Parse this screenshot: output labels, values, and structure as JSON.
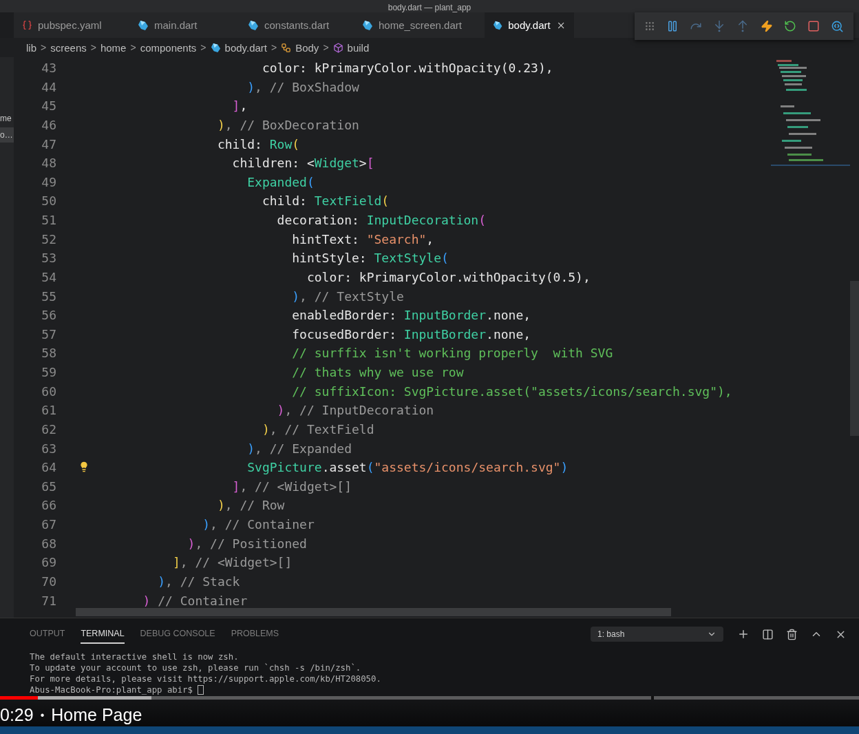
{
  "window": {
    "title": "body.dart — plant_app"
  },
  "tabs": [
    {
      "label": "pubspec.yaml",
      "kind": "yaml",
      "selected": false
    },
    {
      "label": "main.dart",
      "kind": "dart",
      "selected": false
    },
    {
      "label": "constants.dart",
      "kind": "dart",
      "selected": false
    },
    {
      "label": "home_screen.dart",
      "kind": "dart",
      "selected": false
    },
    {
      "label": "body.dart",
      "kind": "dart",
      "selected": true
    }
  ],
  "breadcrumbs": [
    {
      "label": "lib",
      "kind": "folder"
    },
    {
      "separator": ">",
      "label": "screens",
      "kind": "folder"
    },
    {
      "separator": ">",
      "label": "home",
      "kind": "folder"
    },
    {
      "separator": ">",
      "label": "components",
      "kind": "folder"
    },
    {
      "separator": ">",
      "label": "body.dart",
      "kind": "dart"
    },
    {
      "separator": ">",
      "label": "Body",
      "kind": "class"
    },
    {
      "separator": ">",
      "label": "build",
      "kind": "method"
    }
  ],
  "sidebar": {
    "items": [
      {
        "label": "me",
        "selected": false
      },
      {
        "label": "o…",
        "selected": true
      }
    ]
  },
  "editor": {
    "lines": [
      {
        "number": "43",
        "tokens": [
          {
            "t": "                         color: kPrimaryColor.withOpacity(0.23),",
            "kind": "plain"
          }
        ]
      },
      {
        "number": "44",
        "tokens": [
          {
            "t": "                       )",
            "kind": "bracket3"
          },
          {
            "t": ", // BoxShadow",
            "kind": "comment"
          }
        ]
      },
      {
        "number": "45",
        "tokens": [
          {
            "t": "                     ]",
            "kind": "bracket2"
          },
          {
            "t": ",",
            "kind": "plain"
          }
        ]
      },
      {
        "number": "46",
        "tokens": [
          {
            "t": "                   )",
            "kind": "bracket1"
          },
          {
            "t": ", // BoxDecoration",
            "kind": "comment"
          }
        ]
      },
      {
        "number": "47",
        "tokens": [
          {
            "t": "                   child: ",
            "kind": "plain"
          },
          {
            "t": "Row",
            "kind": "type"
          },
          {
            "t": "(",
            "kind": "bracket1"
          }
        ]
      },
      {
        "number": "48",
        "tokens": [
          {
            "t": "                     children: <",
            "kind": "plain"
          },
          {
            "t": "Widget",
            "kind": "type"
          },
          {
            "t": ">",
            "kind": "plain"
          },
          {
            "t": "[",
            "kind": "bracket2"
          }
        ]
      },
      {
        "number": "49",
        "tokens": [
          {
            "t": "                       Expanded",
            "kind": "type"
          },
          {
            "t": "(",
            "kind": "bracket3"
          }
        ]
      },
      {
        "number": "50",
        "tokens": [
          {
            "t": "                         child: ",
            "kind": "plain"
          },
          {
            "t": "TextField",
            "kind": "type"
          },
          {
            "t": "(",
            "kind": "bracket1"
          }
        ]
      },
      {
        "number": "51",
        "tokens": [
          {
            "t": "                           decoration: ",
            "kind": "plain"
          },
          {
            "t": "InputDecoration",
            "kind": "type"
          },
          {
            "t": "(",
            "kind": "bracket2"
          }
        ]
      },
      {
        "number": "52",
        "tokens": [
          {
            "t": "                             hintText: ",
            "kind": "plain"
          },
          {
            "t": "\"Search\"",
            "kind": "string"
          },
          {
            "t": ",",
            "kind": "plain"
          }
        ]
      },
      {
        "number": "53",
        "tokens": [
          {
            "t": "                             hintStyle: ",
            "kind": "plain"
          },
          {
            "t": "TextStyle",
            "kind": "type"
          },
          {
            "t": "(",
            "kind": "bracket3"
          }
        ]
      },
      {
        "number": "54",
        "tokens": [
          {
            "t": "                               color: kPrimaryColor.withOpacity(0.5),",
            "kind": "plain"
          }
        ]
      },
      {
        "number": "55",
        "tokens": [
          {
            "t": "                             )",
            "kind": "bracket3"
          },
          {
            "t": ", // TextStyle",
            "kind": "comment"
          }
        ]
      },
      {
        "number": "56",
        "tokens": [
          {
            "t": "                             enabledBorder: ",
            "kind": "plain"
          },
          {
            "t": "InputBorder",
            "kind": "type"
          },
          {
            "t": ".none,",
            "kind": "plain"
          }
        ]
      },
      {
        "number": "57",
        "tokens": [
          {
            "t": "                             focusedBorder: ",
            "kind": "plain"
          },
          {
            "t": "InputBorder",
            "kind": "type"
          },
          {
            "t": ".none,",
            "kind": "plain"
          }
        ]
      },
      {
        "number": "58",
        "tokens": [
          {
            "t": "                             // surffix isn't working properly  with SVG",
            "kind": "note"
          }
        ]
      },
      {
        "number": "59",
        "tokens": [
          {
            "t": "                             // thats why we use row",
            "kind": "note"
          }
        ]
      },
      {
        "number": "60",
        "tokens": [
          {
            "t": "                             // suffixIcon: SvgPicture.asset(\"assets/icons/search.svg\"),",
            "kind": "note"
          }
        ]
      },
      {
        "number": "61",
        "tokens": [
          {
            "t": "                           )",
            "kind": "bracket2"
          },
          {
            "t": ", // InputDecoration",
            "kind": "comment"
          }
        ]
      },
      {
        "number": "62",
        "tokens": [
          {
            "t": "                         )",
            "kind": "bracket1"
          },
          {
            "t": ", // TextField",
            "kind": "comment"
          }
        ]
      },
      {
        "number": "63",
        "tokens": [
          {
            "t": "                       )",
            "kind": "bracket3"
          },
          {
            "t": ", // Expanded",
            "kind": "comment"
          }
        ]
      },
      {
        "number": "64",
        "lightbulb": true,
        "tokens": [
          {
            "t": "                       SvgPicture",
            "kind": "type"
          },
          {
            "t": ".asset",
            "kind": "plain"
          },
          {
            "t": "(",
            "kind": "bracket3"
          },
          {
            "t": "\"assets/icons/search.svg\"",
            "kind": "string"
          },
          {
            "t": ")",
            "kind": "bracket3"
          }
        ]
      },
      {
        "number": "65",
        "tokens": [
          {
            "t": "                     ]",
            "kind": "bracket2"
          },
          {
            "t": ", // <Widget>[]",
            "kind": "comment"
          }
        ]
      },
      {
        "number": "66",
        "tokens": [
          {
            "t": "                   )",
            "kind": "bracket1"
          },
          {
            "t": ", // Row",
            "kind": "comment"
          }
        ]
      },
      {
        "number": "67",
        "tokens": [
          {
            "t": "                 )",
            "kind": "bracket3"
          },
          {
            "t": ", // Container",
            "kind": "comment"
          }
        ]
      },
      {
        "number": "68",
        "tokens": [
          {
            "t": "               )",
            "kind": "bracket2"
          },
          {
            "t": ", // Positioned",
            "kind": "comment"
          }
        ]
      },
      {
        "number": "69",
        "tokens": [
          {
            "t": "             ]",
            "kind": "bracket1"
          },
          {
            "t": ", // <Widget>[]",
            "kind": "comment"
          }
        ]
      },
      {
        "number": "70",
        "tokens": [
          {
            "t": "           )",
            "kind": "bracket3"
          },
          {
            "t": ", // Stack",
            "kind": "comment"
          }
        ]
      },
      {
        "number": "71",
        "tokens": [
          {
            "t": "         )",
            "kind": "bracket2"
          },
          {
            "t": " // Container",
            "kind": "comment"
          }
        ]
      }
    ]
  },
  "panel": {
    "tabs": [
      {
        "label": "OUTPUT",
        "selected": false
      },
      {
        "label": "TERMINAL",
        "selected": true
      },
      {
        "label": "DEBUG CONSOLE",
        "selected": false
      },
      {
        "label": "PROBLEMS",
        "selected": false
      }
    ],
    "terminal_picker": "1: bash",
    "terminal_lines": [
      "The default interactive shell is now zsh.",
      "To update your account to use zsh, please run `chsh -s /bin/zsh`.",
      "For more details, please visit https://support.apple.com/kb/HT208050."
    ],
    "prompt": "Abus-MacBook-Pro:plant_app abir$"
  },
  "video": {
    "progress": {
      "level": 0.044
    },
    "buffered": {
      "level": 0.176
    },
    "time": "0:29",
    "separator": "•",
    "chapter": "Home Page"
  }
}
